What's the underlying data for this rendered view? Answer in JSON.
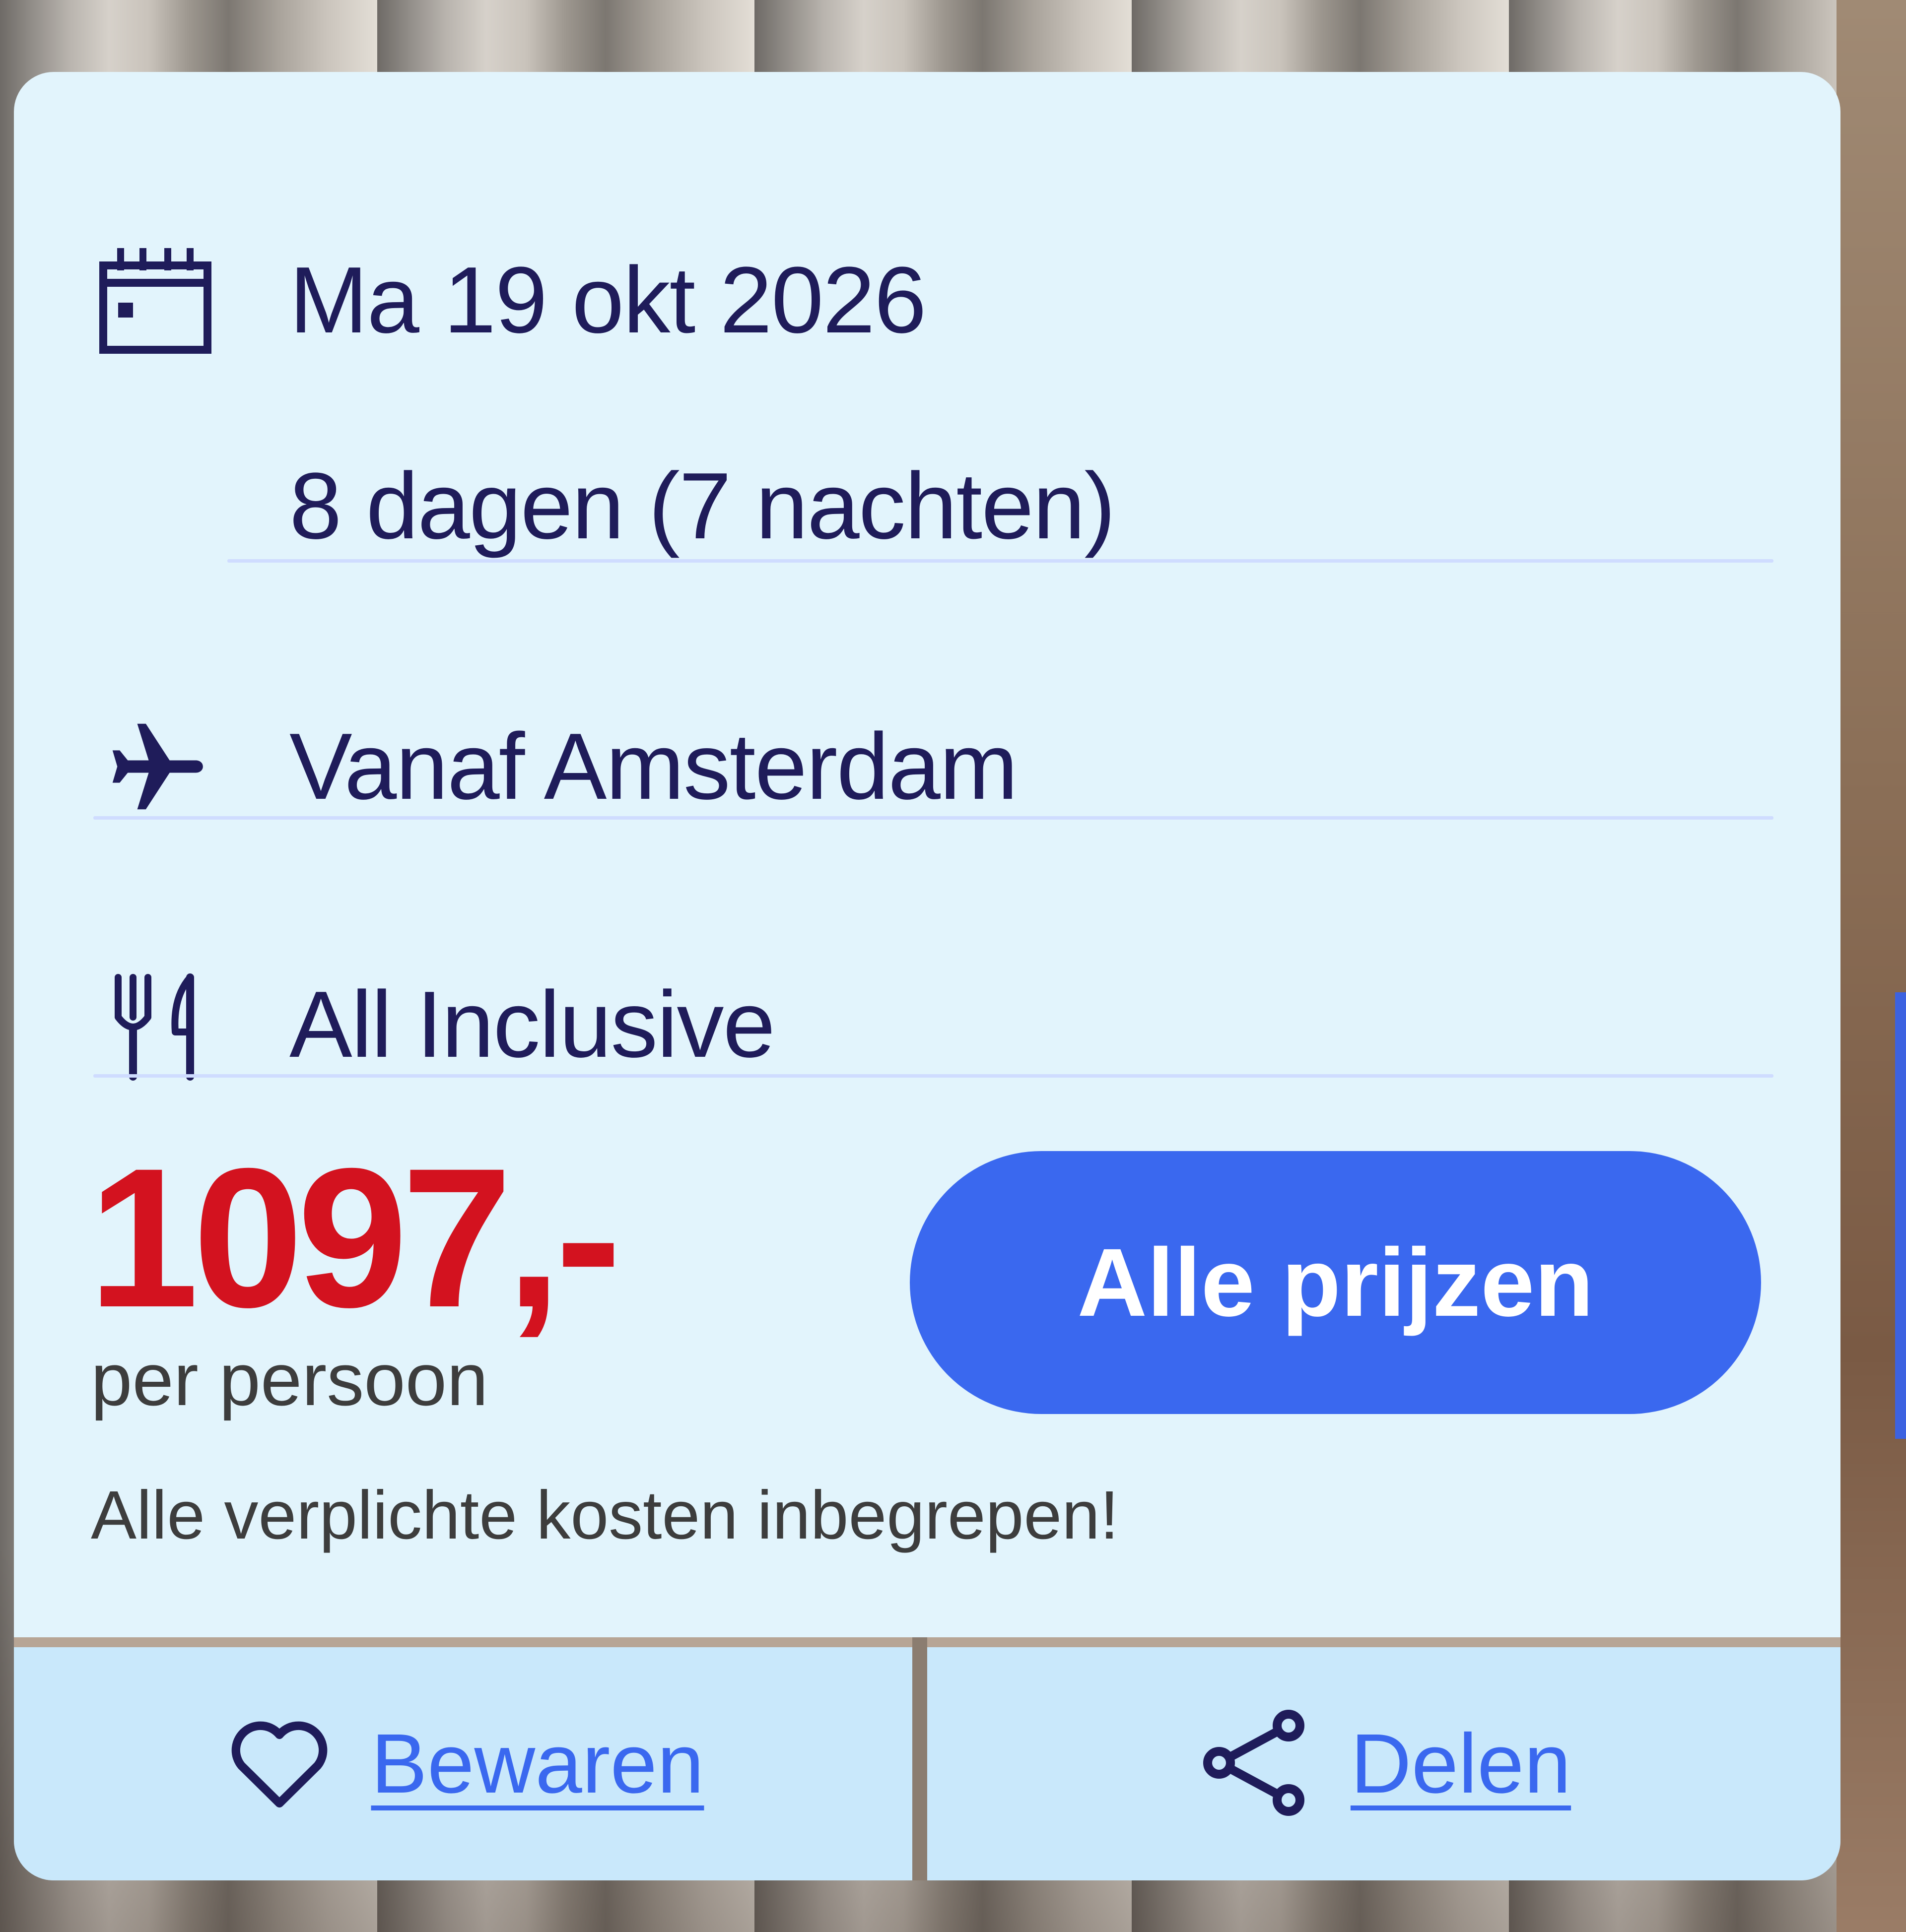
{
  "trip": {
    "date": "Ma 19 okt 2026",
    "duration": "8 dagen (7 nachten)",
    "departure": "Vanaf Amsterdam",
    "board": "All Inclusive"
  },
  "price": {
    "amount": "1097,-",
    "unit": "per persoon",
    "note": "Alle verplichte kosten inbegrepen!"
  },
  "actions": {
    "all_prices": "Alle prijzen",
    "save": "Bewaren",
    "share": "Delen"
  },
  "icons": {
    "date": "calendar-icon",
    "departure": "airplane-icon",
    "board": "cutlery-icon",
    "save": "heart-icon",
    "share": "share-icon"
  },
  "colors": {
    "card_background": "#e2f4fc",
    "text_primary": "#1f1c5a",
    "price": "#d3121f",
    "button": "#3a68ef",
    "footer_background": "#c9e8fb"
  }
}
